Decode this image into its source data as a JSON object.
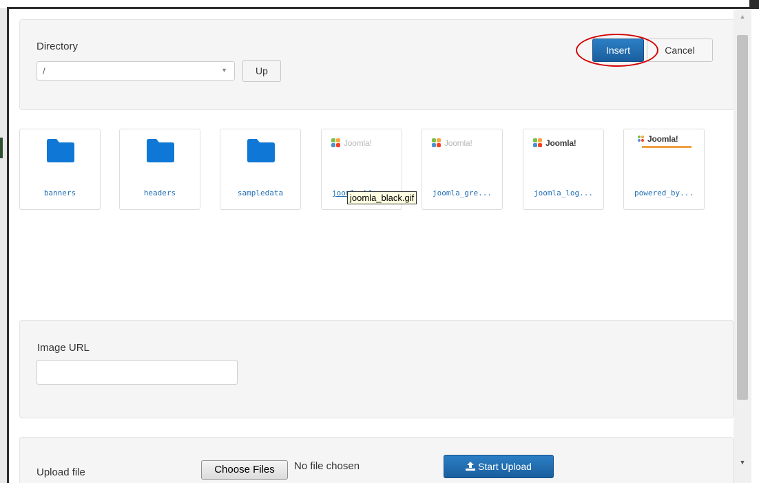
{
  "directory": {
    "label": "Directory",
    "selected": "/",
    "up_label": "Up"
  },
  "actions": {
    "insert_label": "Insert",
    "cancel_label": "Cancel"
  },
  "items": [
    {
      "name": "banners",
      "type": "folder"
    },
    {
      "name": "headers",
      "type": "folder"
    },
    {
      "name": "sampledata",
      "type": "folder"
    },
    {
      "name": "joomla_bla...",
      "type": "image",
      "logo_text": "Joomla!"
    },
    {
      "name": "joomla_gre...",
      "type": "image",
      "logo_text": "Joomla!"
    },
    {
      "name": "joomla_log...",
      "type": "image",
      "logo_text": "Joomla!"
    },
    {
      "name": "powered_by...",
      "type": "image",
      "logo_text": "Joomla!"
    }
  ],
  "tooltip": "joomla_black.gif",
  "image_url": {
    "label": "Image URL",
    "value": ""
  },
  "upload": {
    "label": "Upload file",
    "choose_label": "Choose Files",
    "status": "No file chosen",
    "start_label": "Start Upload"
  },
  "colors": {
    "primary": "#1f6eb5",
    "folder": "#0f78d6",
    "highlight": "#d40000",
    "well": "#f5f5f5"
  }
}
